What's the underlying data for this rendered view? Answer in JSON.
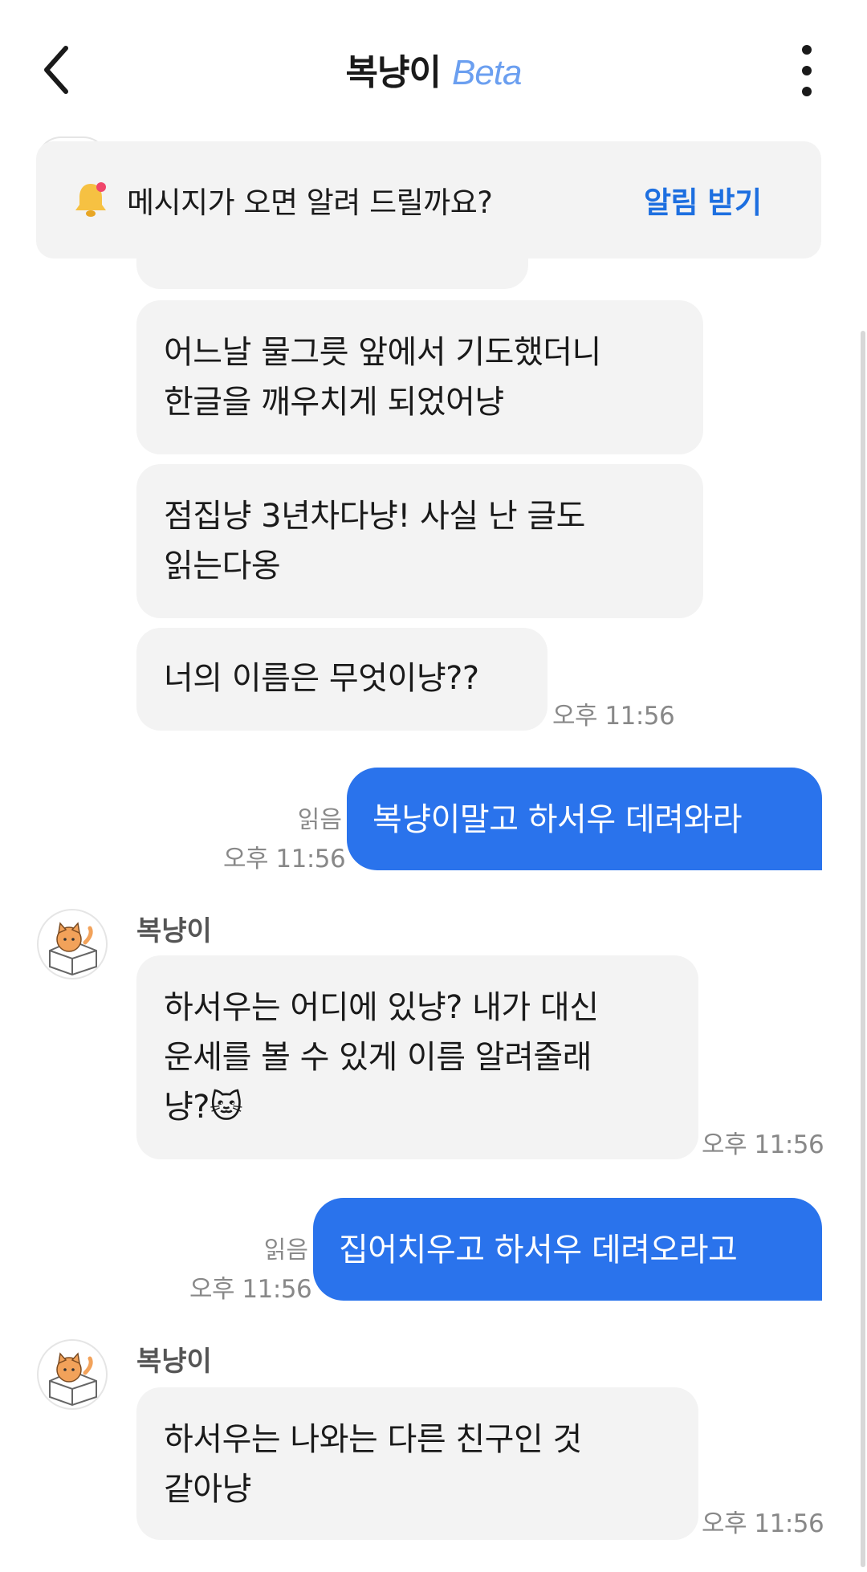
{
  "header": {
    "title": "복냥이",
    "beta": "Beta"
  },
  "banner": {
    "text": "메시지가 오면 알려 드릴까요?",
    "action": "알림 받기"
  },
  "messages": {
    "in1": "어느날 물그릇 앞에서 기도했더니\n한글을 깨우치게 되었어냥",
    "in2": "점집냥 3년차다냥! 사실 난 글도\n읽는다옹",
    "in3": "너의 이름은 무엇이냥??",
    "in3_time": "오후 11:56",
    "out1": "복냥이말고 하서우 데려와라",
    "out1_read": "읽음",
    "out1_time": "오후 11:56",
    "sender1": "복냥이",
    "in4": "하서우는 어디에 있냥? 내가 대신\n운세를 볼 수 있게 이름 알려줄래\n냥?🐱",
    "in4_time": "오후 11:56",
    "out2": "집어치우고 하서우 데려오라고",
    "out2_read": "읽음",
    "out2_time": "오후 11:56",
    "sender2": "복냥이",
    "in5": "하서우는 나와는 다른 친구인 것\n같아냥",
    "in5_time": "오후 11:56"
  },
  "colors": {
    "accent": "#1d6fe0",
    "out_bubble": "#2a73ec",
    "in_bubble": "#f3f3f3",
    "beta": "#6b9ff0"
  }
}
